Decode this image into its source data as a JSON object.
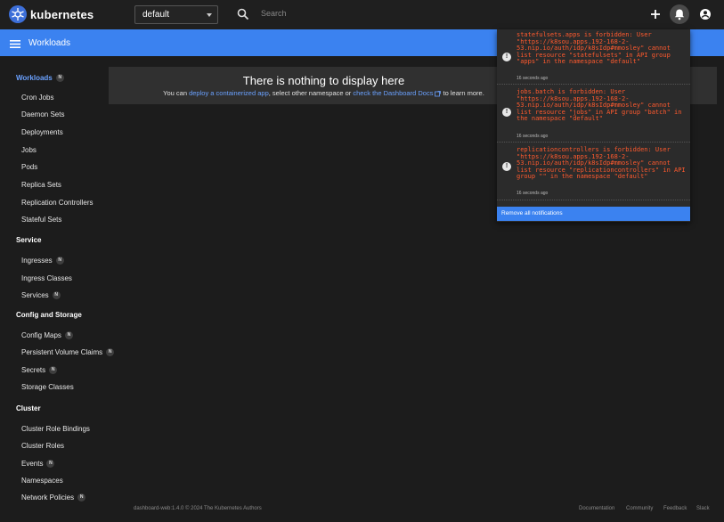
{
  "app": {
    "name": "kubernetes",
    "brand_color": "#3d6fd9",
    "accent_color": "#3b82f0"
  },
  "header": {
    "namespace": "default",
    "search_placeholder": "Search",
    "icons": [
      "kubernetes-logo",
      "chevron-down-icon",
      "search-icon",
      "plus-icon",
      "bell-icon",
      "account-icon"
    ]
  },
  "toolbar": {
    "title": "Workloads",
    "menu_icon": "menu-icon"
  },
  "sidebar": {
    "workloads_header": "Workloads",
    "workloads_badge": "N",
    "workloads_items": [
      "Cron Jobs",
      "Daemon Sets",
      "Deployments",
      "Jobs",
      "Pods",
      "Replica Sets",
      "Replication Controllers",
      "Stateful Sets"
    ],
    "service_header": "Service",
    "service_items": [
      {
        "label": "Ingresses",
        "badge": "N"
      },
      {
        "label": "Ingress Classes"
      },
      {
        "label": "Services",
        "badge": "N"
      }
    ],
    "config_header": "Config and Storage",
    "config_items": [
      {
        "label": "Config Maps",
        "badge": "N"
      },
      {
        "label": "Persistent Volume Claims",
        "badge": "N"
      },
      {
        "label": "Secrets",
        "badge": "N"
      },
      {
        "label": "Storage Classes"
      }
    ],
    "cluster_header": "Cluster",
    "cluster_items": [
      {
        "label": "Cluster Role Bindings"
      },
      {
        "label": "Cluster Roles"
      },
      {
        "label": "Events",
        "badge": "N"
      },
      {
        "label": "Namespaces"
      },
      {
        "label": "Network Policies",
        "badge": "N"
      }
    ]
  },
  "main": {
    "empty_title": "There is nothing to display here",
    "empty_prefix": "You can ",
    "deploy_link": "deploy a containerized app",
    "empty_middle": ", select other namespace or ",
    "docs_link": "check the Dashboard Docs",
    "empty_suffix": " to learn more."
  },
  "notifications": {
    "items": [
      {
        "message": "statefulsets.apps is forbidden: User \"https://k8sou.apps.192-168-2-53.nip.io/auth/idp/k8sIdp#mmosley\" cannot list resource \"statefulsets\" in API group \"apps\" in the namespace \"default\"",
        "time": "16 seconds ago"
      },
      {
        "message": "jobs.batch is forbidden: User \"https://k8sou.apps.192-168-2-53.nip.io/auth/idp/k8sIdp#mmosley\" cannot list resource \"jobs\" in API group \"batch\" in the namespace \"default\"",
        "time": "16 seconds ago"
      },
      {
        "message": "replicationcontrollers is forbidden: User \"https://k8sou.apps.192-168-2-53.nip.io/auth/idp/k8sIdp#mmosley\" cannot list resource \"replicationcontrollers\" in API group \"\" in the namespace \"default\"",
        "time": "16 seconds ago"
      }
    ],
    "remove_all": "Remove all notifications",
    "error_color": "#ff5a2e"
  },
  "footer": {
    "version": "dashboard-web:1.4.0 © 2024 The Kubernetes Authors",
    "links": [
      "Documentation",
      "Community",
      "Feedback",
      "Slack"
    ]
  }
}
